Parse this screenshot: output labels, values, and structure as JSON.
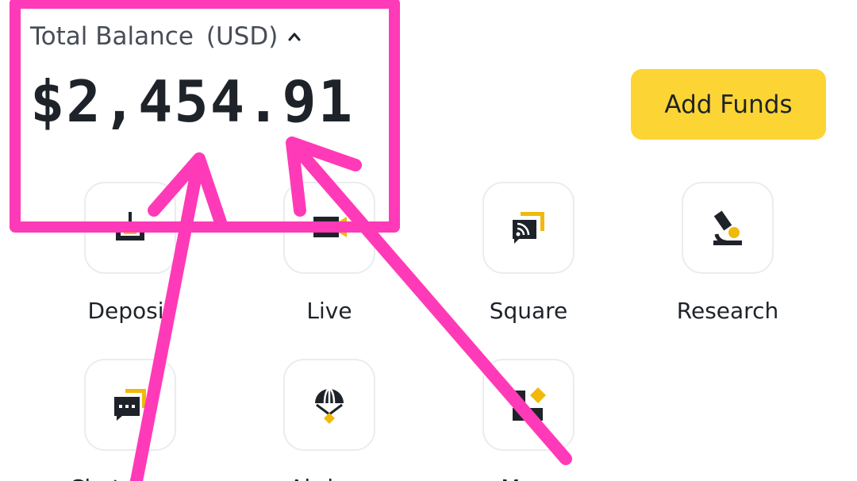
{
  "balance": {
    "label": "Total Balance",
    "currency": "(USD)",
    "amount": "$2,454.91"
  },
  "actions": {
    "add_funds": "Add Funds"
  },
  "shortcuts": [
    {
      "label": "Deposit",
      "icon": "deposit-icon"
    },
    {
      "label": "Live",
      "icon": "live-icon"
    },
    {
      "label": "Square",
      "icon": "square-icon"
    },
    {
      "label": "Research",
      "icon": "research-icon"
    },
    {
      "label": "Chat Room",
      "icon": "chat-room-icon"
    },
    {
      "label": "Airdrop",
      "icon": "airdrop-icon"
    },
    {
      "label": "More",
      "icon": "more-icon"
    }
  ],
  "colors": {
    "accent": "#fcd535",
    "text": "#1e2329",
    "annotation": "#ff3ab8"
  }
}
